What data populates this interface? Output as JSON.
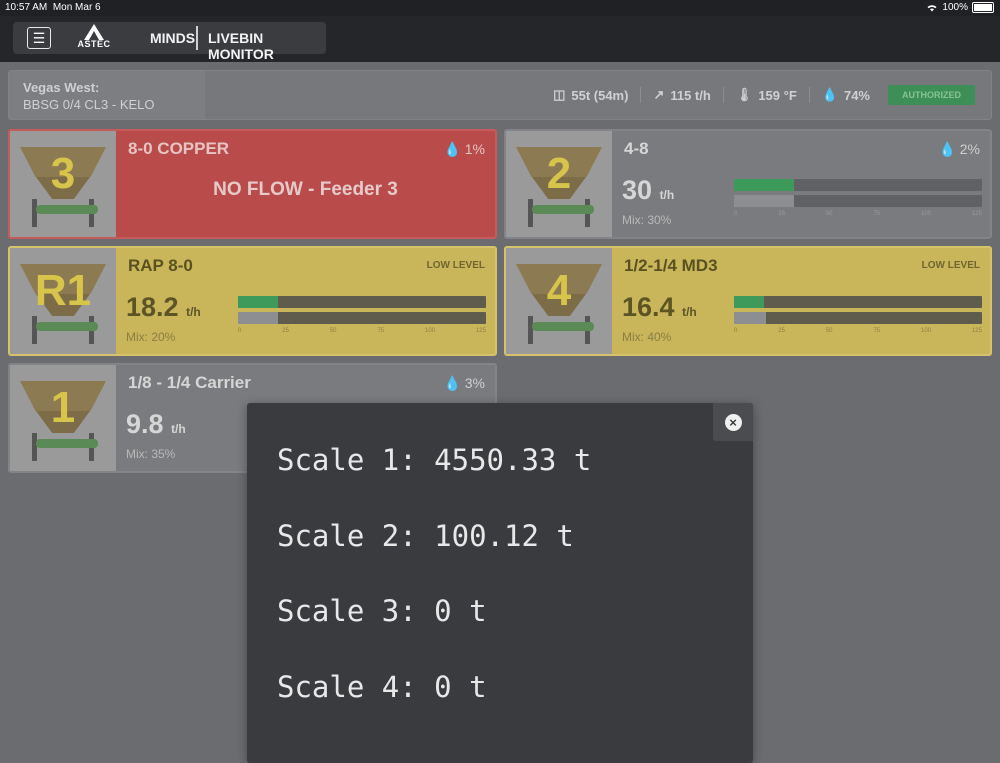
{
  "status": {
    "time": "10:57 AM",
    "date": "Mon Mar 6",
    "battery": "100%"
  },
  "app": {
    "logo_text": "ASTEC",
    "product": "MINDS",
    "module": "LIVEBIN MONITOR"
  },
  "plant": {
    "site": "Vegas West:",
    "mix": "BBSG 0/4 CL3 - KELO",
    "stats": [
      {
        "icon": "scale-icon",
        "value": "55t (54m)"
      },
      {
        "icon": "trend-icon",
        "value": "115 t/h"
      },
      {
        "icon": "thermometer-icon",
        "value": "159 °F"
      },
      {
        "icon": "droplet-icon",
        "value": "74%"
      }
    ],
    "status": "AUTHORIZED"
  },
  "bins": [
    {
      "number": "3",
      "material": "8-0 COPPER",
      "moisture": "1%",
      "state": "alarm",
      "alarm_text": "NO FLOW - Feeder 3"
    },
    {
      "number": "2",
      "material": "4-8",
      "moisture": "2%",
      "state": "normal",
      "rate": "30",
      "unit": "t/h",
      "mix": "Mix: 30%",
      "bar_actual": 0.24,
      "bar_target": 0.24
    },
    {
      "number": "R1",
      "material": "RAP 8-0",
      "badge": "LOW LEVEL",
      "state": "low",
      "rate": "18.2",
      "unit": "t/h",
      "mix": "Mix: 20%",
      "bar_actual": 0.16,
      "bar_target": 0.16
    },
    {
      "number": "4",
      "material": "1/2-1/4 MD3",
      "badge": "LOW LEVEL",
      "state": "low",
      "rate": "16.4",
      "unit": "t/h",
      "mix": "Mix: 40%",
      "bar_actual": 0.12,
      "bar_target": 0.13
    },
    {
      "number": "1",
      "material": "1/8 - 1/4 Carrier",
      "moisture": "3%",
      "state": "normal",
      "rate": "9.8",
      "unit": "t/h",
      "mix": "Mix: 35%"
    }
  ],
  "bar_ticks": [
    "0",
    "25",
    "50",
    "75",
    "100",
    "125"
  ],
  "scales": [
    {
      "label": "Scale 1:",
      "value": "4550.33 t"
    },
    {
      "label": "Scale 2:",
      "value": "100.12 t"
    },
    {
      "label": "Scale 3:",
      "value": "0 t"
    },
    {
      "label": "Scale 4:",
      "value": "0 t"
    }
  ],
  "colors": {
    "alarm": "#b94b4b",
    "low": "#c9b65a",
    "normal": "#7a7b7e",
    "bar_actual": "#3e9a5a",
    "authorized": "#3e8e58"
  }
}
